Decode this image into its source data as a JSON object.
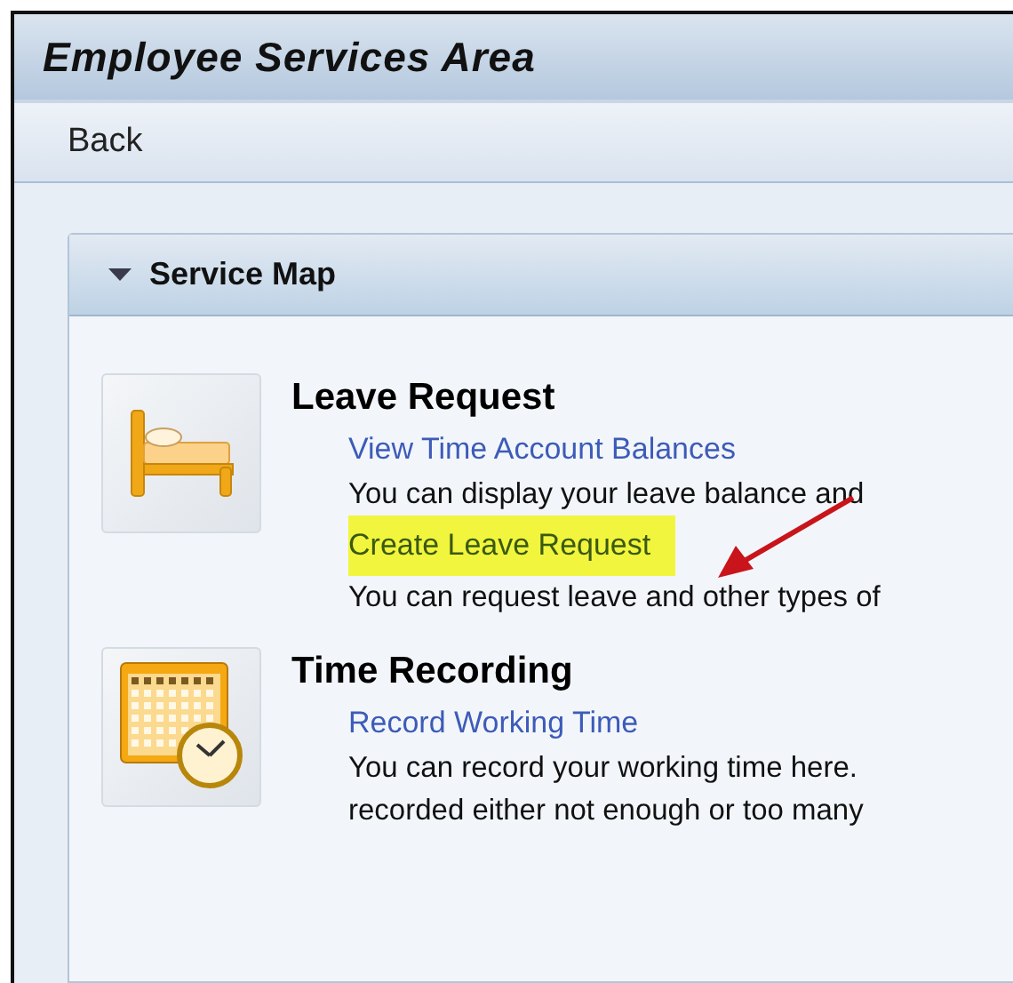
{
  "window": {
    "title": "Employee Services Area"
  },
  "toolbar": {
    "buttons": [
      "Back"
    ]
  },
  "panel": {
    "title": "Service Map",
    "expanded": true,
    "groups": [
      {
        "kind": "leave",
        "title": "Leave Request",
        "entries": [
          {
            "link": "View  Time Account Balances",
            "highlighted": false,
            "description": "You can display your leave balance and"
          },
          {
            "link": "Create Leave Request",
            "highlighted": true,
            "description": "You can request leave and other types of"
          }
        ]
      },
      {
        "kind": "time",
        "title": "Time Recording",
        "entries": [
          {
            "link": "Record Working Time",
            "highlighted": false,
            "description": "You can record your working time here.\nrecorded either not enough or too many"
          }
        ]
      }
    ]
  }
}
